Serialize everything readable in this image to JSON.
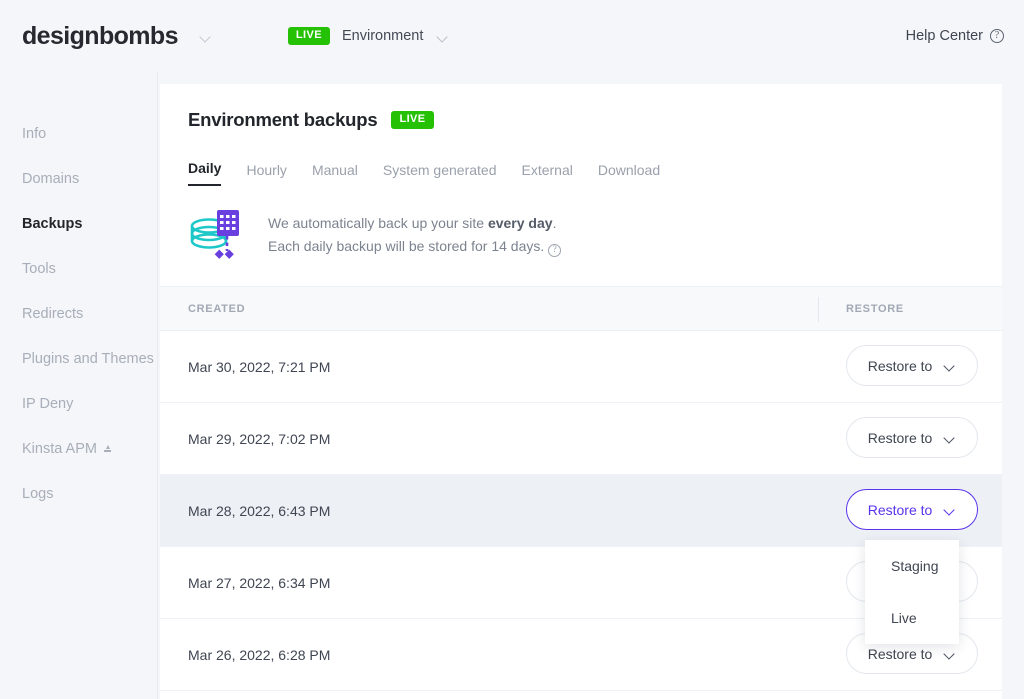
{
  "topbar": {
    "brand": "designbombs",
    "brand_caret_icon": "chevron-down-icon",
    "env_badge": "LIVE",
    "env_label": "Environment",
    "env_caret_icon": "chevron-down-icon",
    "help_label": "Help Center",
    "help_icon": "question-circle-icon"
  },
  "sidebar": {
    "items": [
      {
        "label": "Info",
        "active": false
      },
      {
        "label": "Domains",
        "active": false
      },
      {
        "label": "Backups",
        "active": true
      },
      {
        "label": "Tools",
        "active": false
      },
      {
        "label": "Redirects",
        "active": false
      },
      {
        "label": "Plugins and Themes",
        "active": false
      },
      {
        "label": "IP Deny",
        "active": false
      },
      {
        "label": "Kinsta APM",
        "active": false,
        "badge_icon": "new-flag-icon"
      },
      {
        "label": "Logs",
        "active": false
      }
    ]
  },
  "card": {
    "title": "Environment backups",
    "title_badge": "LIVE",
    "tabs": [
      {
        "label": "Daily",
        "active": true
      },
      {
        "label": "Hourly",
        "active": false
      },
      {
        "label": "Manual",
        "active": false
      },
      {
        "label": "System generated",
        "active": false
      },
      {
        "label": "External",
        "active": false
      },
      {
        "label": "Download",
        "active": false
      }
    ],
    "info": {
      "icon": "database-calendar-icon",
      "line1_prefix": "We automatically back up your site ",
      "line1_bold": "every day",
      "line1_suffix": ".",
      "line2": "Each daily backup will be stored for 14 days.",
      "help_icon": "question-circle-icon"
    },
    "table": {
      "columns": [
        "CREATED",
        "RESTORE"
      ],
      "rows": [
        {
          "created": "Mar 30, 2022, 7:21 PM",
          "restore_label": "Restore to",
          "active": false
        },
        {
          "created": "Mar 29, 2022, 7:02 PM",
          "restore_label": "Restore to",
          "active": false
        },
        {
          "created": "Mar 28, 2022, 6:43 PM",
          "restore_label": "Restore to",
          "active": true
        },
        {
          "created": "Mar 27, 2022, 6:34 PM",
          "restore_label": "Restore to",
          "active": false
        },
        {
          "created": "Mar 26, 2022, 6:28 PM",
          "restore_label": "Restore to",
          "active": false
        }
      ]
    },
    "restore_dropdown": {
      "open": true,
      "options": [
        "Staging",
        "Live"
      ]
    }
  },
  "colors": {
    "accent_purple": "#5a33ec",
    "live_green": "#24c104",
    "page_bg": "#f4f6f9",
    "row_highlight": "#edf1f6",
    "icon_teal": "#1ec8c8",
    "icon_purple": "#6a3fe0"
  }
}
